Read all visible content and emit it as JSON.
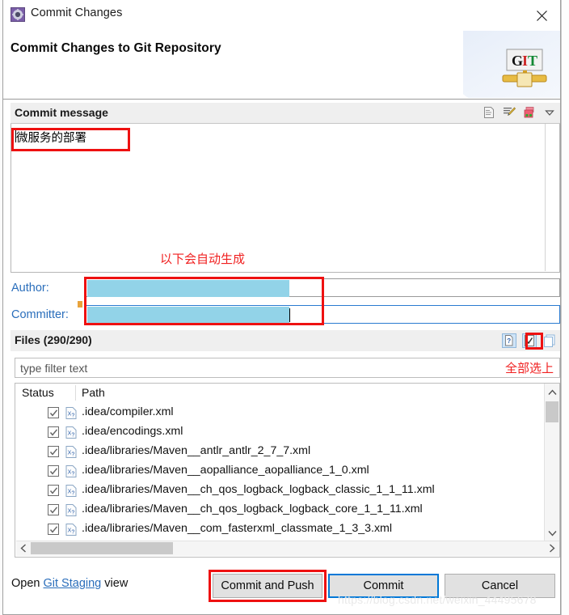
{
  "window": {
    "title": "Commit Changes",
    "title_icon": "gear-icon",
    "close_icon": "close-icon"
  },
  "header": {
    "heading": "Commit Changes to Git Repository",
    "logo_text_g": "G",
    "logo_text_i": "I",
    "logo_text_t": "T",
    "logo_name": "git-logo"
  },
  "commit_message": {
    "section_label": "Commit message",
    "value": "微服务的部署",
    "tools": [
      {
        "name": "insert-signed-off-icon"
      },
      {
        "name": "amend-edit-icon"
      },
      {
        "name": "add-change-id-icon"
      },
      {
        "name": "chevron-down-icon"
      }
    ],
    "annotation": "以下会自动生成"
  },
  "author": {
    "label": "Author:",
    "value": ""
  },
  "committer": {
    "label": "Committer:",
    "value": ""
  },
  "files": {
    "section_label": "Files (290/290)",
    "count_selected": "290",
    "count_total": "290",
    "tools": [
      {
        "name": "show-untracked-icon"
      },
      {
        "name": "select-all-icon"
      },
      {
        "name": "deselect-all-icon"
      }
    ],
    "annotation": "全部选上",
    "filter_placeholder": "type filter text",
    "columns": [
      "Status",
      "Path"
    ],
    "rows": [
      {
        "checked": true,
        "icon": "xml-file-icon",
        "path": ".idea/compiler.xml"
      },
      {
        "checked": true,
        "icon": "xml-file-icon",
        "path": ".idea/encodings.xml"
      },
      {
        "checked": true,
        "icon": "xml-file-icon",
        "path": ".idea/libraries/Maven__antlr_antlr_2_7_7.xml"
      },
      {
        "checked": true,
        "icon": "xml-file-icon",
        "path": ".idea/libraries/Maven__aopalliance_aopalliance_1_0.xml"
      },
      {
        "checked": true,
        "icon": "xml-file-icon",
        "path": ".idea/libraries/Maven__ch_qos_logback_logback_classic_1_1_11.xml"
      },
      {
        "checked": true,
        "icon": "xml-file-icon",
        "path": ".idea/libraries/Maven__ch_qos_logback_logback_core_1_1_11.xml"
      },
      {
        "checked": true,
        "icon": "xml-file-icon",
        "path": ".idea/libraries/Maven__com_fasterxml_classmate_1_3_3.xml"
      }
    ]
  },
  "footer": {
    "open_prefix": "Open ",
    "open_link": "Git Staging",
    "open_suffix": " view",
    "commit_and_push": "Commit and Push",
    "commit": "Commit",
    "cancel": "Cancel"
  },
  "watermark": "https://blog.csdn.net/weixin_44495678",
  "colors": {
    "annotation_red": "#ee1111",
    "link_blue": "#2a6ebb",
    "focus_blue": "#0078d7",
    "redaction": "#92d3e8"
  }
}
